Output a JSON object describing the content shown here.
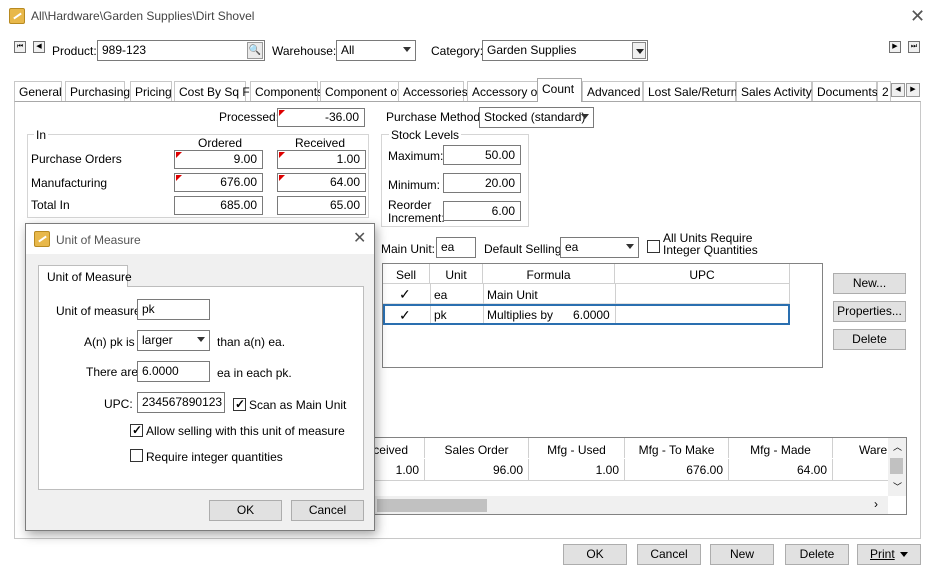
{
  "window": {
    "title": "All\\Hardware\\Garden Supplies\\Dirt Shovel"
  },
  "header": {
    "product_label": "Product:",
    "product_value": "989-123",
    "warehouse_label": "Warehouse:",
    "warehouse_value": "All",
    "category_label": "Category:",
    "category_value": "Garden Supplies"
  },
  "tabs": [
    "General",
    "Purchasing",
    "Pricing",
    "Cost By Sq Ft",
    "Components",
    "Component of",
    "Accessories",
    "Accessory of",
    "Count",
    "Advanced",
    "Lost Sale/Return",
    "Sales Activity",
    "Documents",
    "2"
  ],
  "active_tab": "Count",
  "count": {
    "processed_label": "Processed:",
    "processed_value": "-36.00",
    "purchase_method_label": "Purchase Method:",
    "purchase_method_value": "Stocked (standard)",
    "in_group": "In",
    "col_ordered": "Ordered",
    "col_received": "Received",
    "rows": [
      {
        "label": "Purchase Orders",
        "ordered": "9.00",
        "received": "1.00"
      },
      {
        "label": "Manufacturing",
        "ordered": "676.00",
        "received": "64.00"
      },
      {
        "label": "Total In",
        "ordered": "685.00",
        "received": "65.00"
      }
    ],
    "stock_group": "Stock Levels",
    "maximum_label": "Maximum:",
    "maximum_value": "50.00",
    "minimum_label": "Minimum:",
    "minimum_value": "20.00",
    "reorder_label_1": "Reorder",
    "reorder_label_2": "Increment:",
    "reorder_value": "6.00"
  },
  "units": {
    "main_unit_label": "Main Unit:",
    "main_unit_value": "ea",
    "default_selling_label": "Default Selling:",
    "default_selling_value": "ea",
    "all_units_label_1": "All Units Require",
    "all_units_label_2": "Integer Quantities",
    "columns": [
      "Sell",
      "Unit",
      "Formula",
      "UPC"
    ],
    "rows": [
      {
        "sell": "✓",
        "unit": "ea",
        "formula": "Main Unit",
        "upc": ""
      },
      {
        "sell": "✓",
        "unit": "pk",
        "formula": "Multiplies by      6.0000",
        "upc": ""
      }
    ],
    "new_button": "New...",
    "properties_button": "Properties...",
    "delete_button": "Delete"
  },
  "summary": {
    "columns": [
      "eceived",
      "Sales Order",
      "Mfg - Used",
      "Mfg - To Make",
      "Mfg - Made",
      "Ware"
    ],
    "values": [
      "1.00",
      "96.00",
      "1.00",
      "676.00",
      "64.00",
      ""
    ]
  },
  "footer": {
    "ok": "OK",
    "cancel": "Cancel",
    "new": "New",
    "delete": "Delete",
    "print": "Print"
  },
  "dialog": {
    "title": "Unit of Measure",
    "tab": "Unit of Measure",
    "uom_label": "Unit of measure:",
    "uom_value": "pk",
    "relation_prefix": "A(n) pk is",
    "relation_value": "larger",
    "relation_suffix": "than a(n) ea.",
    "there_are_label": "There are",
    "there_are_value": "6.0000",
    "there_are_suffix": "ea in each pk.",
    "upc_label": "UPC:",
    "upc_value": "234567890123",
    "scan_label": "Scan as Main Unit",
    "scan_checked": true,
    "allow_selling_label": "Allow selling with this unit of measure",
    "allow_selling_checked": true,
    "require_integer_label": "Require integer quantities",
    "require_integer_checked": false,
    "ok": "OK",
    "cancel": "Cancel"
  }
}
